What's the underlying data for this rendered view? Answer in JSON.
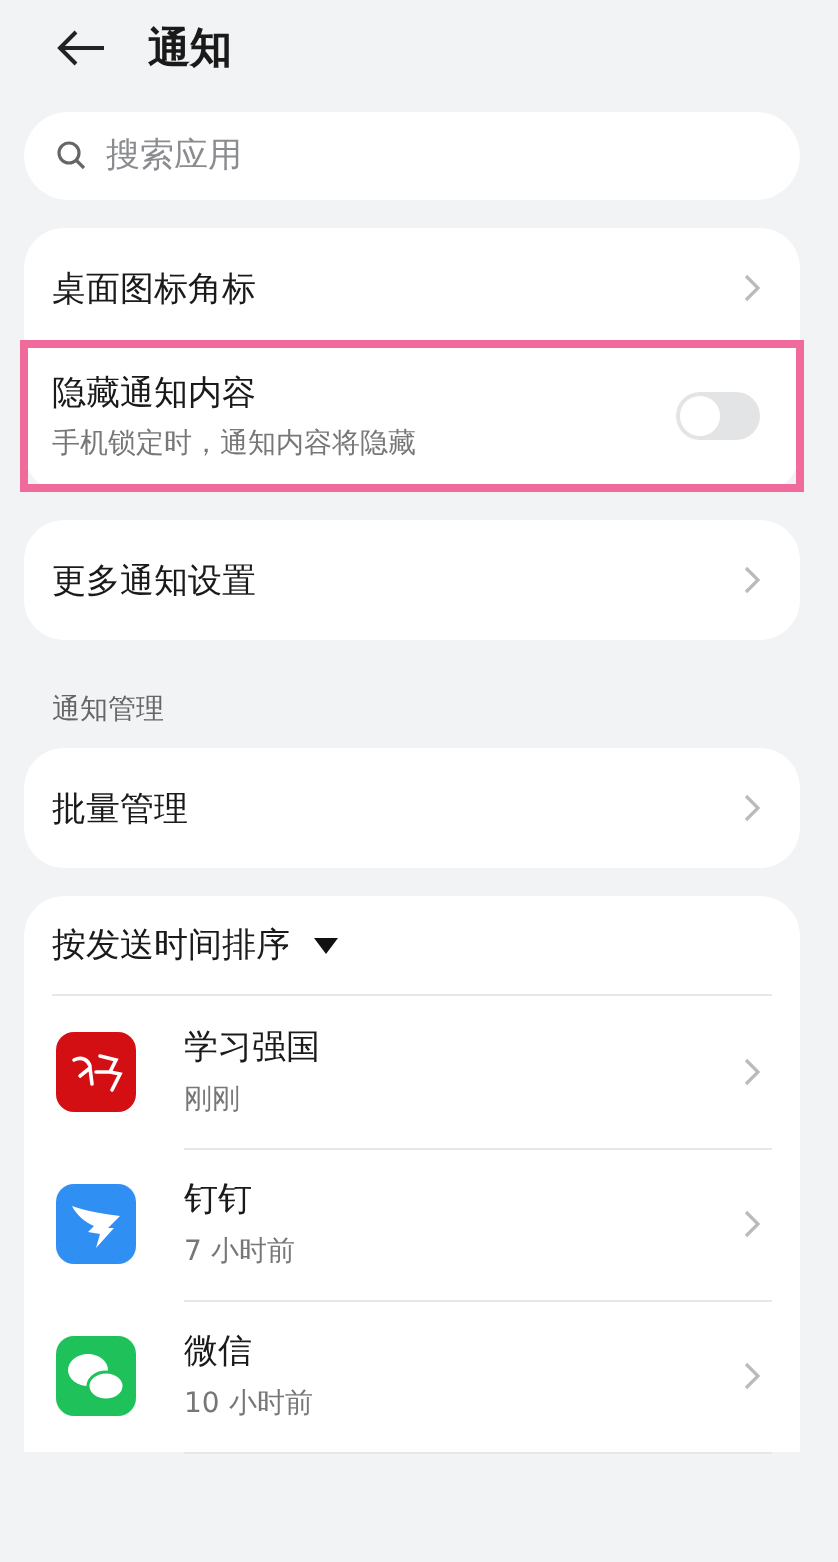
{
  "title": "通知",
  "search": {
    "placeholder": "搜索应用"
  },
  "groups": [
    {
      "rows": [
        {
          "kind": "link",
          "label": "桌面图标角标",
          "highlighted": false
        },
        {
          "kind": "switch",
          "label": "隐藏通知内容",
          "subtitle": "手机锁定时，通知内容将隐藏",
          "on": false,
          "highlighted": true
        }
      ]
    },
    {
      "rows": [
        {
          "kind": "link",
          "label": "更多通知设置",
          "highlighted": false
        }
      ]
    },
    {
      "heading": "通知管理",
      "rows": [
        {
          "kind": "link",
          "label": "批量管理",
          "highlighted": false
        }
      ]
    }
  ],
  "app_list": {
    "sort_label": "按发送时间排序",
    "apps": [
      {
        "kind": "study",
        "name": "学习强国",
        "time": "刚刚"
      },
      {
        "kind": "ding",
        "name": "钉钉",
        "time": "7 小时前"
      },
      {
        "kind": "chat",
        "name": "微信",
        "time": "10 小时前"
      }
    ]
  }
}
